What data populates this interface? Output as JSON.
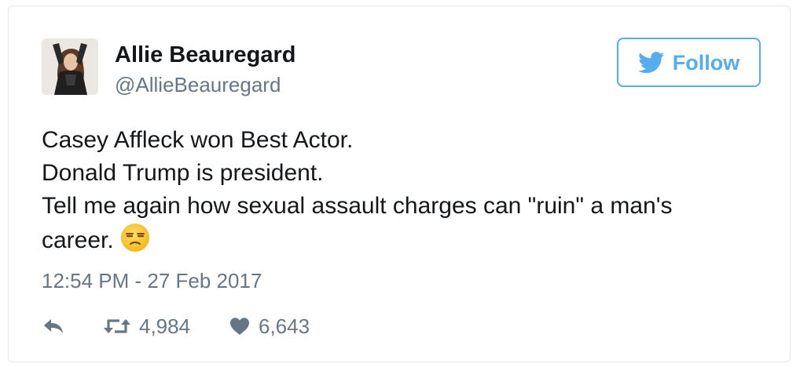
{
  "user": {
    "display_name": "Allie Beauregard",
    "handle": "@AllieBeauregard"
  },
  "follow_button": {
    "label": "Follow",
    "icon": "twitter-bird-icon"
  },
  "tweet": {
    "lines": [
      "Casey Affleck won Best Actor.",
      "Donald Trump is president.",
      "Tell me again how sexual assault charges can \"ruin\" a man's",
      "career."
    ],
    "emoji": "unamused-face-icon",
    "timestamp": "12:54 PM - 27 Feb 2017"
  },
  "actions": {
    "reply": {
      "icon": "reply-icon"
    },
    "retweet": {
      "icon": "retweet-icon",
      "count": "4,984"
    },
    "like": {
      "icon": "heart-icon",
      "count": "6,643"
    }
  },
  "colors": {
    "accent": "#55acee",
    "text_primary": "#14171a",
    "text_secondary": "#657786",
    "border": "#e1e8ed"
  }
}
